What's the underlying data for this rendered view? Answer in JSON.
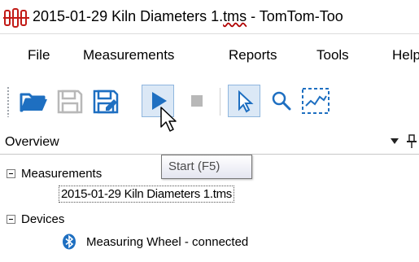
{
  "window": {
    "title_prefix": "2015-01-29 Kiln Diameters 1.",
    "title_file_ext": "tms",
    "title_suffix": " - TomTom-Too",
    "icon": "tomtom-app-icon"
  },
  "menu": {
    "items": [
      {
        "label": "File"
      },
      {
        "label": "Measurements"
      },
      {
        "label": "Reports"
      },
      {
        "label": "Tools"
      },
      {
        "label": "Help"
      }
    ]
  },
  "toolbar": {
    "buttons": [
      {
        "icon": "open-folder-icon"
      },
      {
        "icon": "save-disabled-icon"
      },
      {
        "icon": "save-as-icon"
      },
      {
        "icon": "play-icon",
        "state": "pressed"
      },
      {
        "icon": "stop-disabled-icon"
      },
      {
        "icon": "select-pointer-icon"
      },
      {
        "icon": "zoom-icon"
      },
      {
        "icon": "chart-selection-icon"
      }
    ]
  },
  "tooltip": {
    "text": "Start (F5)"
  },
  "overview": {
    "title": "Overview",
    "tree": {
      "measurements_label": "Measurements",
      "measurement_file": "2015-01-29 Kiln Diameters 1.tms",
      "devices_label": "Devices",
      "device": "Measuring Wheel - connected"
    }
  },
  "colors": {
    "accent_blue": "#1e6fc1",
    "pressed_bg": "#dbe8f6",
    "disabled_gray": "#b8b8b8"
  }
}
